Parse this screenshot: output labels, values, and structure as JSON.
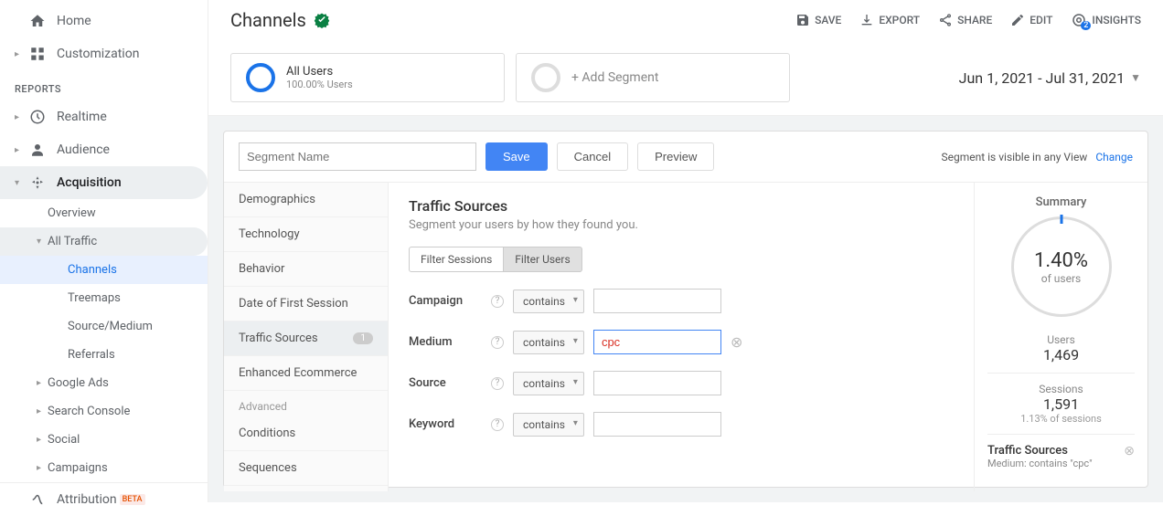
{
  "sidebar": {
    "home": "Home",
    "customization": "Customization",
    "reports_label": "REPORTS",
    "realtime": "Realtime",
    "audience": "Audience",
    "acquisition": "Acquisition",
    "acq_children": {
      "overview": "Overview",
      "all_traffic": "All Traffic",
      "channels": "Channels",
      "treemaps": "Treemaps",
      "source_medium": "Source/Medium",
      "referrals": "Referrals",
      "google_ads": "Google Ads",
      "search_console": "Search Console",
      "social": "Social",
      "campaigns": "Campaigns"
    },
    "attribution": "Attribution",
    "beta": "BETA"
  },
  "header": {
    "title": "Channels",
    "actions": {
      "save": "SAVE",
      "export": "EXPORT",
      "share": "SHARE",
      "edit": "EDIT",
      "insights": "INSIGHTS",
      "insights_count": "2"
    }
  },
  "segments": {
    "all_users": "All Users",
    "all_users_sub": "100.00% Users",
    "add_segment": "+ Add Segment"
  },
  "date_range": "Jun 1, 2021 - Jul 31, 2021",
  "editor": {
    "name_placeholder": "Segment Name",
    "save": "Save",
    "cancel": "Cancel",
    "preview": "Preview",
    "visibility": "Segment is visible in any View",
    "change": "Change",
    "left_items": {
      "demographics": "Demographics",
      "technology": "Technology",
      "behavior": "Behavior",
      "date_first": "Date of First Session",
      "traffic_sources": "Traffic Sources",
      "traffic_sources_count": "1",
      "enhanced_ecom": "Enhanced Ecommerce",
      "advanced": "Advanced",
      "conditions": "Conditions",
      "sequences": "Sequences"
    },
    "center": {
      "title": "Traffic Sources",
      "subtitle": "Segment your users by how they found you.",
      "filter_sessions": "Filter Sessions",
      "filter_users": "Filter Users",
      "fields": {
        "campaign": "Campaign",
        "medium": "Medium",
        "source": "Source",
        "keyword": "Keyword"
      },
      "contains": "contains",
      "medium_value": "cpc"
    },
    "summary": {
      "title": "Summary",
      "pct": "1.40%",
      "of_users": "of users",
      "users_label": "Users",
      "users_value": "1,469",
      "sessions_label": "Sessions",
      "sessions_value": "1,591",
      "sessions_sub": "1.13% of sessions",
      "filter_title": "Traffic Sources",
      "filter_sub": "Medium: contains \"cpc\""
    }
  }
}
